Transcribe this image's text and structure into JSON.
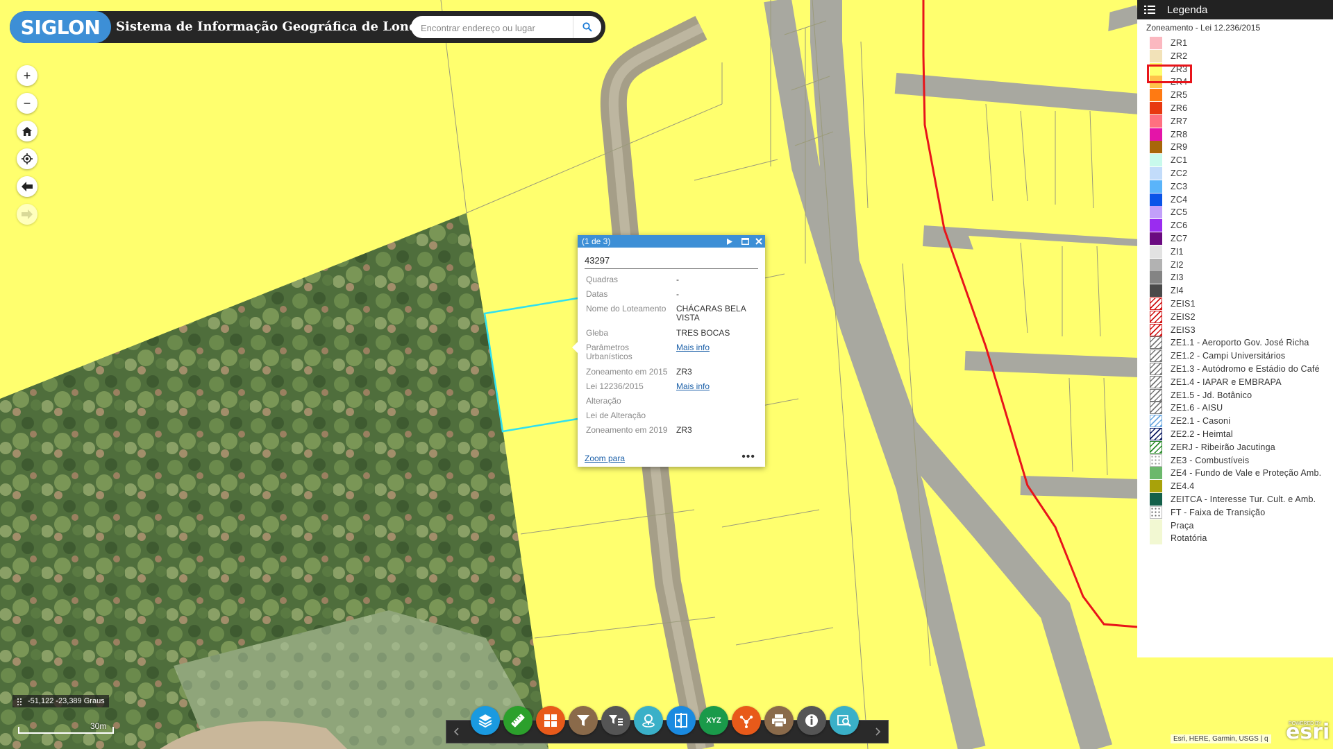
{
  "header": {
    "logo": "SIGLON",
    "title": "Sistema de Informação Geográfica de Londrina",
    "search_placeholder": "Encontrar endereço ou lugar"
  },
  "nav": {
    "zoom_in": "+",
    "zoom_out": "−"
  },
  "popup": {
    "counter": "(1 de 3)",
    "feature_id": "43297",
    "attributes": [
      {
        "key": "Quadras",
        "value": "-"
      },
      {
        "key": "Datas",
        "value": "-"
      },
      {
        "key": "Nome do Loteamento",
        "value": "CHÁCARAS BELA VISTA"
      },
      {
        "key": "Gleba",
        "value": "TRES BOCAS"
      },
      {
        "key": "Parâmetros Urbanísticos",
        "value": "Mais info",
        "link": true
      },
      {
        "key": "Zoneamento em 2015",
        "value": "ZR3"
      },
      {
        "key": "Lei 12236/2015",
        "value": "Mais info",
        "link": true
      },
      {
        "key": "Alteração",
        "value": ""
      },
      {
        "key": "Lei de Alteração",
        "value": ""
      },
      {
        "key": "Zoneamento em 2019",
        "value": "ZR3"
      }
    ],
    "zoom_link": "Zoom para",
    "more": "•••"
  },
  "legend": {
    "title": "Legenda",
    "layer": "Zoneamento - Lei 12.236/2015",
    "highlighted": "ZR3",
    "items": [
      {
        "label": "ZR1",
        "color": "#fbb8c0",
        "pattern": "solid"
      },
      {
        "label": "ZR2",
        "color": "#f2e2b8",
        "pattern": "solid"
      },
      {
        "label": "ZR3",
        "color": "#ffff6e",
        "pattern": "solid"
      },
      {
        "label": "ZR4",
        "color": "#ffc24a",
        "pattern": "solid"
      },
      {
        "label": "ZR5",
        "color": "#ff7a12",
        "pattern": "solid"
      },
      {
        "label": "ZR6",
        "color": "#e8380f",
        "pattern": "solid"
      },
      {
        "label": "ZR7",
        "color": "#ff7080",
        "pattern": "solid"
      },
      {
        "label": "ZR8",
        "color": "#e414a8",
        "pattern": "solid"
      },
      {
        "label": "ZR9",
        "color": "#a8660a",
        "pattern": "solid"
      },
      {
        "label": "ZC1",
        "color": "#c8faec",
        "pattern": "solid"
      },
      {
        "label": "ZC2",
        "color": "#c2dcfa",
        "pattern": "solid"
      },
      {
        "label": "ZC3",
        "color": "#5ab4fa",
        "pattern": "solid"
      },
      {
        "label": "ZC4",
        "color": "#0a54e8",
        "pattern": "solid"
      },
      {
        "label": "ZC5",
        "color": "#c2a0fa",
        "pattern": "solid"
      },
      {
        "label": "ZC6",
        "color": "#9a2cf0",
        "pattern": "solid"
      },
      {
        "label": "ZC7",
        "color": "#6a0a80",
        "pattern": "solid"
      },
      {
        "label": "ZI1",
        "color": "#e2e2e2",
        "pattern": "solid"
      },
      {
        "label": "ZI2",
        "color": "#b2b2b2",
        "pattern": "solid"
      },
      {
        "label": "ZI3",
        "color": "#848484",
        "pattern": "solid"
      },
      {
        "label": "ZI4",
        "color": "#4a4a4a",
        "pattern": "solid"
      },
      {
        "label": "ZEIS1",
        "color": "#d01010",
        "pattern": "hatch"
      },
      {
        "label": "ZEIS2",
        "color": "#d01010",
        "pattern": "hatch"
      },
      {
        "label": "ZEIS3",
        "color": "#d01010",
        "pattern": "hatch"
      },
      {
        "label": "ZE1.1 - Aeroporto Gov. José Richa",
        "color": "#777777",
        "pattern": "hatch"
      },
      {
        "label": "ZE1.2 - Campi Universitários",
        "color": "#777777",
        "pattern": "hatch"
      },
      {
        "label": "ZE1.3 - Autódromo e Estádio do Café",
        "color": "#777777",
        "pattern": "hatch"
      },
      {
        "label": "ZE1.4 - IAPAR e EMBRAPA",
        "color": "#777777",
        "pattern": "hatch"
      },
      {
        "label": "ZE1.5 - Jd. Botânico",
        "color": "#777777",
        "pattern": "hatch"
      },
      {
        "label": "ZE1.6 - AISU",
        "color": "#777777",
        "pattern": "hatch"
      },
      {
        "label": "ZE2.1 - Casoni",
        "color": "#6aa8e0",
        "pattern": "hatch"
      },
      {
        "label": "ZE2.2 - Heimtal",
        "color": "#0a1a60",
        "pattern": "hatch"
      },
      {
        "label": "ZERJ - Ribeirão Jacutinga",
        "color": "#2a8a2a",
        "pattern": "hatch"
      },
      {
        "label": "ZE3 - Combustíveis",
        "color": "#999999",
        "pattern": "dots"
      },
      {
        "label": "ZE4 - Fundo de Vale e Proteção Amb.",
        "color": "#6cb86c",
        "pattern": "solid"
      },
      {
        "label": "ZE4.4",
        "color": "#a8a20a",
        "pattern": "solid"
      },
      {
        "label": "ZEITCA - Interesse Tur. Cult. e Amb.",
        "color": "#14604a",
        "pattern": "solid"
      },
      {
        "label": "FT - Faixa de Transição",
        "color": "#666666",
        "pattern": "dots"
      },
      {
        "label": "Praça",
        "color": "#f2f8d2",
        "pattern": "solid"
      },
      {
        "label": "Rotatória",
        "color": "#f2f8d2",
        "pattern": "solid"
      }
    ]
  },
  "coordinates": "-51,122 -23,389 Graus",
  "scale_label": "30m",
  "toolbar": [
    {
      "name": "layers-tool",
      "icon": "layers-icon",
      "color": "#1a9ae0"
    },
    {
      "name": "measure-tool",
      "icon": "ruler-icon",
      "color": "#2ca02c"
    },
    {
      "name": "basemap-tool",
      "icon": "grid-icon",
      "color": "#e85a1a"
    },
    {
      "name": "filter-tool",
      "icon": "filter-icon",
      "color": "#8a6a4a"
    },
    {
      "name": "attribute-filter-tool",
      "icon": "filter-list-icon",
      "color": "#555555"
    },
    {
      "name": "locate-tool",
      "icon": "pin-icon",
      "color": "#3ab0c8"
    },
    {
      "name": "compare-tool",
      "icon": "split-icon",
      "color": "#1a8ae0"
    },
    {
      "name": "coordinate-tool",
      "icon": "xyz-icon",
      "text": "XYZ",
      "color": "#1a9a4a"
    },
    {
      "name": "share-tool",
      "icon": "share-icon",
      "color": "#e85a1a"
    },
    {
      "name": "print-tool",
      "icon": "print-icon",
      "color": "#8a6a4a"
    },
    {
      "name": "about-tool",
      "icon": "info-icon",
      "color": "#555555"
    },
    {
      "name": "search-tool",
      "icon": "search-icon",
      "color": "#3ab0c8"
    }
  ],
  "attribution": "Esri, HERE, Garmin, USGS | q",
  "esri": {
    "powered": "POWERED BY",
    "logo": "esri"
  }
}
